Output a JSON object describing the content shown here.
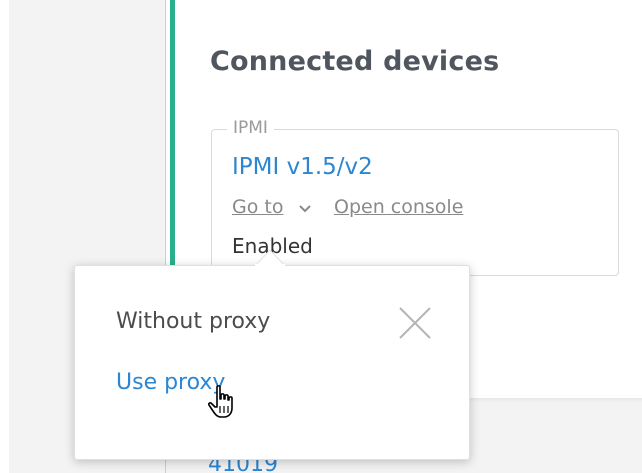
{
  "section": {
    "title": "Connected devices"
  },
  "device_card": {
    "legend": "IPMI",
    "name": "IPMI v1.5/v2",
    "goto_label": "Go to",
    "open_console_label": "Open console",
    "status": "Enabled"
  },
  "background": {
    "partial_number": "41019"
  },
  "popup": {
    "options": [
      {
        "label": "Without proxy"
      },
      {
        "label": "Use proxy"
      }
    ]
  },
  "icons": {
    "chevron": "chevron-down-icon",
    "close": "close-icon",
    "cursor": "hand-pointer-icon",
    "warning": "warning-icon"
  },
  "colors": {
    "accent": "#2aaf8d",
    "link": "#2c86d1",
    "title": "#4f5660",
    "warning": "#f2b01e"
  }
}
